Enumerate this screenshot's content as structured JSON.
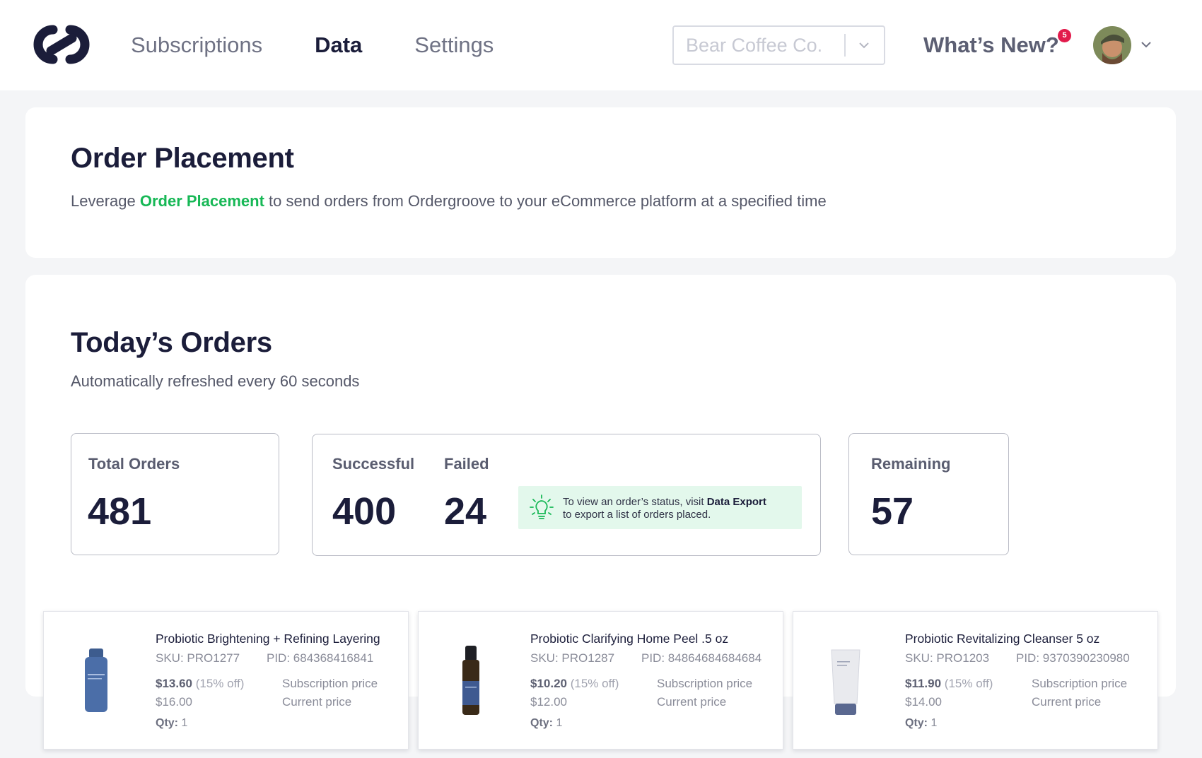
{
  "nav": {
    "items": [
      {
        "label": "Subscriptions",
        "active": false
      },
      {
        "label": "Data",
        "active": true
      },
      {
        "label": "Settings",
        "active": false
      }
    ],
    "store_select": {
      "value": "Bear Coffee Co."
    },
    "whats_new": {
      "label": "What’s New?",
      "badge": "5"
    },
    "icons": {
      "logo": "ordergroove-logo",
      "chevron": "chevron-down-icon",
      "avatar": "user-avatar"
    }
  },
  "order_placement": {
    "title": "Order Placement",
    "description_prefix": "Leverage ",
    "description_link": "Order Placement",
    "description_suffix": " to send orders from Ordergroove to your eCommerce platform at a specified time"
  },
  "todays_orders": {
    "title": "Today’s Orders",
    "subtitle": "Automatically refreshed every 60 seconds",
    "stats": {
      "total_label": "Total Orders",
      "total_value": "481",
      "successful_label": "Successful",
      "successful_value": "400",
      "failed_label": "Failed",
      "failed_value": "24",
      "remaining_label": "Remaining",
      "remaining_value": "57"
    },
    "tip": {
      "line1_prefix": "To view an order’s status, visit ",
      "line1_link": "Data Export",
      "line2": "to export a list of orders placed.",
      "icon": "lightbulb-icon"
    }
  },
  "products": [
    {
      "name": "Probiotic Brightening + Refining Layering",
      "sku": "SKU: PRO1277",
      "pid": "PID: 684368416841",
      "sub_price": "$13.60",
      "discount": "(15% off)",
      "sub_price_label": "Subscription price",
      "current_price": "$16.00",
      "current_price_label": "Current price",
      "qty_label": "Qty:",
      "qty": "1"
    },
    {
      "name": "Probiotic Clarifying Home Peel .5 oz",
      "sku": "SKU: PRO1287",
      "pid": "PID: 84864684684684",
      "sub_price": "$10.20",
      "discount": "(15% off)",
      "sub_price_label": "Subscription price",
      "current_price": "$12.00",
      "current_price_label": "Current price",
      "qty_label": "Qty:",
      "qty": "1"
    },
    {
      "name": "Probiotic Revitalizing Cleanser 5 oz",
      "sku": "SKU: PRO1203",
      "pid": "PID: 9370390230980",
      "sub_price": "$11.90",
      "discount": "(15% off)",
      "sub_price_label": "Subscription price",
      "current_price": "$14.00",
      "current_price_label": "Current price",
      "qty_label": "Qty:",
      "qty": "1"
    }
  ],
  "colors": {
    "accent_green": "#17b856",
    "tip_bg": "#e3f8ec",
    "badge_red": "#e21b4c",
    "text_dark": "#1b1d3a"
  }
}
